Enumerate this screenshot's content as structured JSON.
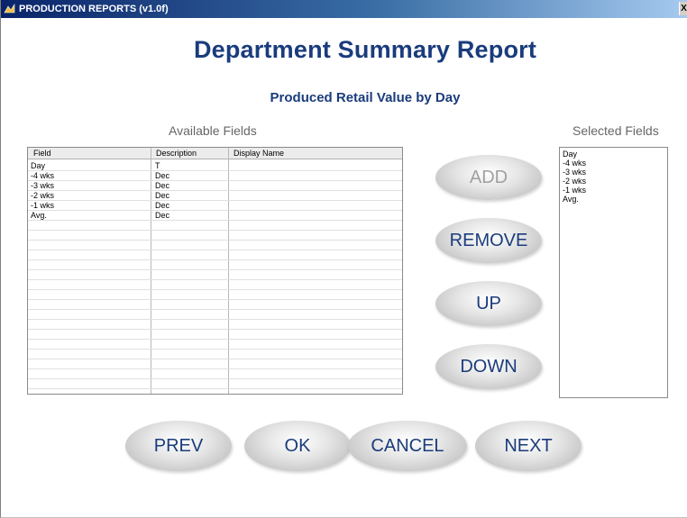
{
  "window": {
    "title": "PRODUCTION REPORTS (v1.0f)",
    "close_glyph": "X"
  },
  "report": {
    "title": "Department Summary Report",
    "subtitle": "Produced Retail Value by Day"
  },
  "available": {
    "label": "Available Fields",
    "columns": [
      "Field",
      "Description",
      "Display Name"
    ],
    "rows": [
      {
        "field": "Day",
        "description": "T",
        "display_name": ""
      },
      {
        "field": "-4 wks",
        "description": "Dec",
        "display_name": ""
      },
      {
        "field": "-3 wks",
        "description": "Dec",
        "display_name": ""
      },
      {
        "field": "-2 wks",
        "description": "Dec",
        "display_name": ""
      },
      {
        "field": "-1 wks",
        "description": "Dec",
        "display_name": ""
      },
      {
        "field": "Avg.",
        "description": "Dec",
        "display_name": ""
      }
    ]
  },
  "selected": {
    "label": "Selected Fields",
    "items": [
      "Day",
      "-4 wks",
      "-3 wks",
      "-2 wks",
      "-1 wks",
      "Avg."
    ]
  },
  "buttons": {
    "add": "ADD",
    "remove": "REMOVE",
    "up": "UP",
    "down": "DOWN",
    "prev": "PREV",
    "ok": "OK",
    "cancel": "CANCEL",
    "next": "NEXT"
  },
  "colors": {
    "title_text": "#1a3c7c",
    "disabled_text": "#a0a0a0",
    "label_gray": "#666666"
  }
}
